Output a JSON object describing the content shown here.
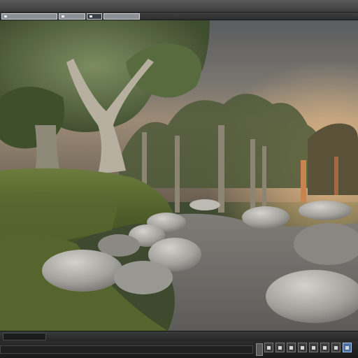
{
  "window": {
    "tabs": [
      {
        "label": "",
        "active": true
      },
      {
        "label": "",
        "active": false
      },
      {
        "label": "",
        "active": false
      },
      {
        "label": "",
        "active": false
      }
    ]
  },
  "viewport": {
    "scene": "forest-rocks-render"
  },
  "colors": {
    "ui_dark": "#2a2a2a",
    "accent": "#4a6fa5"
  }
}
